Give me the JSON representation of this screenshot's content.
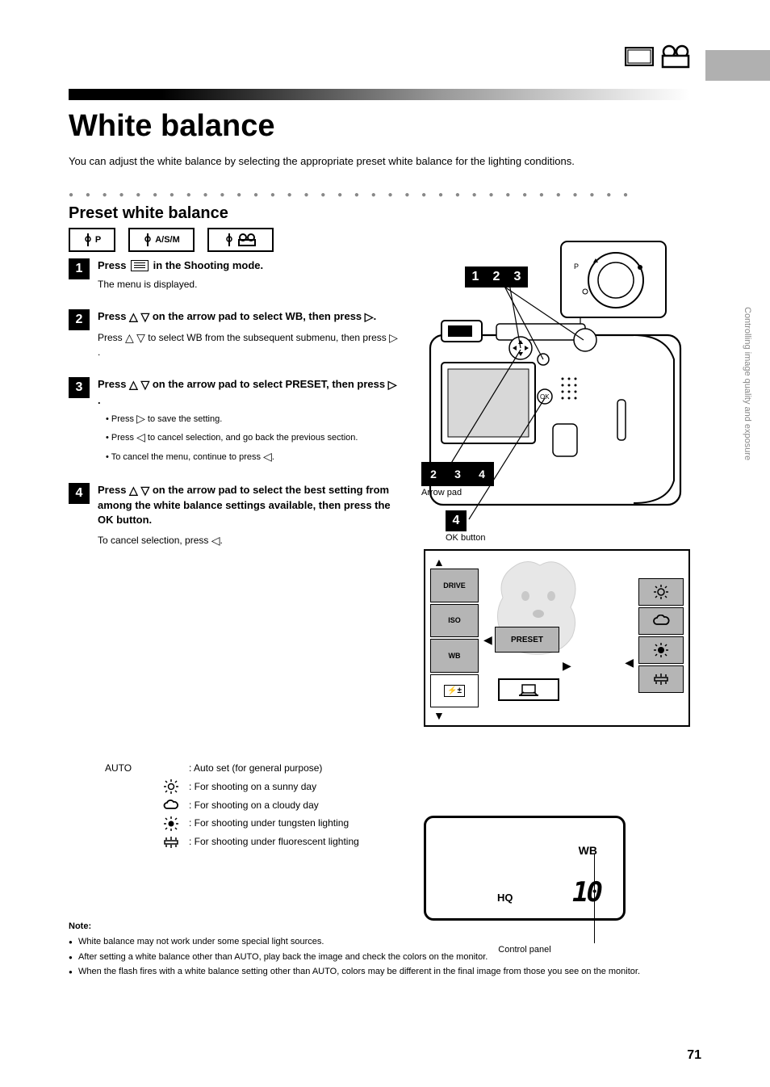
{
  "header": {
    "title": "White balance"
  },
  "intro": "You can adjust the white balance by selecting the appropriate preset white balance for the lighting conditions.",
  "preset": {
    "heading": "Preset white balance"
  },
  "dialPositions": [
    "P",
    "A/S/M",
    "movie"
  ],
  "steps": {
    "s1": {
      "main": "Press            in the Shooting mode.",
      "sub": "The menu is displayed."
    },
    "s2": {
      "main": "Press △ ▽ on the arrow pad to select WB, then press ▷.",
      "sub": "Press △ ▽ to select WB from the subsequent submenu, then press ▷."
    },
    "s3": {
      "main": "Press △ ▽ on the arrow pad to select PRESET, then press ▷.",
      "bullets": [
        "Press ▷ to save the setting.",
        "Press ◁ to cancel selection, and go back the previous section.",
        "To cancel the menu, continue to press ◁."
      ]
    },
    "s4": {
      "main": "Press △ ▽ on the arrow pad to select the best setting from among the white balance settings available, then press the OK button.",
      "sub": "To cancel selection, press ◁."
    }
  },
  "callouts": {
    "a": "1",
    "b": "2",
    "c": "3",
    "d": "4",
    "arrowPad": "Arrow pad",
    "okBtn": "OK button"
  },
  "settings": [
    {
      "label": "AUTO",
      "icon": "",
      "desc": ": Auto set (for general purpose)"
    },
    {
      "label": "",
      "icon": "sun",
      "desc": ": For shooting on a sunny day"
    },
    {
      "label": "",
      "icon": "cloud",
      "desc": ": For shooting on a cloudy day"
    },
    {
      "label": "",
      "icon": "bulb",
      "desc": ": For shooting under tungsten lighting"
    },
    {
      "label": "",
      "icon": "fluor",
      "desc": ": For shooting under fluorescent lighting"
    }
  ],
  "menuScreen": {
    "col1": [
      "DRIVE",
      "ISO",
      "WB",
      "FLASH"
    ],
    "center": {
      "wb": "PRESET",
      "drive": "drive"
    },
    "col3": [
      "sun",
      "cloud",
      "bulb",
      "fluor"
    ]
  },
  "controlPanel": {
    "wb": "WB",
    "hq": "HQ",
    "count": "10",
    "caption": "Control panel"
  },
  "notes": {
    "label": "Note:",
    "items": [
      "White balance may not work under some special light sources.",
      "After setting a white balance other than AUTO, play back the image and check the colors on the monitor.",
      "When the flash fires with a white balance setting other than AUTO, colors may be different in the final image from those you see on the monitor."
    ]
  },
  "pageNumber": "71",
  "sideText": "Controlling image quality and exposure"
}
